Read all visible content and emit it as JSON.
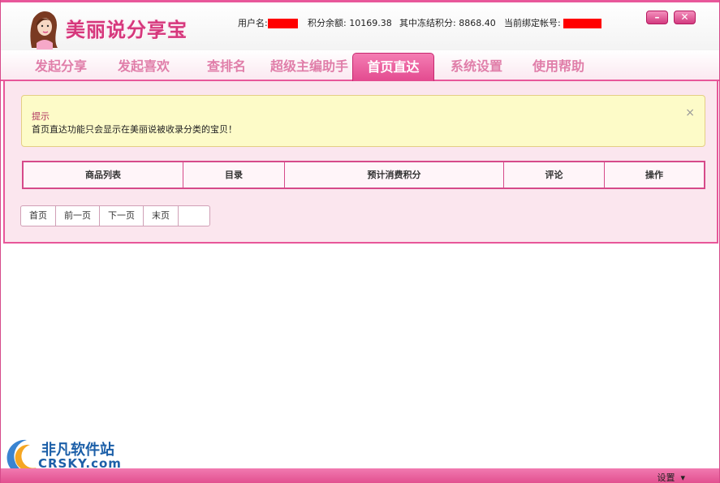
{
  "app": {
    "title": "美丽说分享宝"
  },
  "header": {
    "username_label": "用户名:",
    "points_balance_label": "积分余额:",
    "points_balance": "10169.38",
    "frozen_points_label": "其中冻结积分:",
    "frozen_points": "8868.40",
    "bound_account_label": "当前绑定帐号:"
  },
  "window_controls": {
    "minimize": "–",
    "close": "✕"
  },
  "tabs": [
    {
      "label": "发起分享",
      "active": false
    },
    {
      "label": "发起喜欢",
      "active": false
    },
    {
      "label": "查排名",
      "active": false
    },
    {
      "label": "超级主编助手",
      "active": false
    },
    {
      "label": "首页直达",
      "active": true
    },
    {
      "label": "系统设置",
      "active": false
    },
    {
      "label": "使用帮助",
      "active": false
    }
  ],
  "notice": {
    "title": "提示",
    "text": "首页直达功能只会显示在美丽说被收录分类的宝贝！",
    "close": "×"
  },
  "table": {
    "columns": [
      "商品列表",
      "目录",
      "预计消费积分",
      "评论",
      "操作"
    ]
  },
  "pager": {
    "first": "首页",
    "prev": "前一页",
    "next": "下一页",
    "last": "末页"
  },
  "statusbar": {
    "settings_label": "设置"
  },
  "watermark": {
    "line1": "非凡软件站",
    "line2": "CRSKY.com"
  },
  "colors": {
    "accent": "#e8579a",
    "tab_inactive": "#e07ea9",
    "content_bg": "#fbe6ee",
    "notice_bg": "#fdfbc8",
    "redaction": "#ff0000"
  },
  "icons": {
    "logo": "girl-avatar-icon",
    "minimize": "minimize-icon",
    "close": "close-icon",
    "dropdown": "chevron-down-icon"
  }
}
